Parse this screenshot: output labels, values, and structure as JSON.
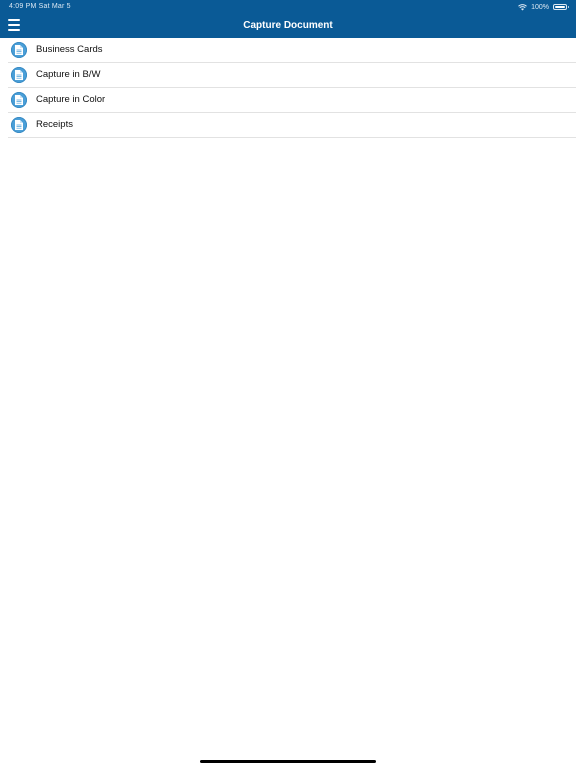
{
  "status_bar": {
    "time_date": "4:09 PM   Sat Mar 5",
    "battery_text": "100%"
  },
  "header": {
    "title": "Capture Document",
    "background_color": "#0a5a96"
  },
  "list": {
    "items": [
      {
        "label": "Business Cards",
        "icon": "document-icon"
      },
      {
        "label": "Capture in B/W",
        "icon": "document-icon"
      },
      {
        "label": "Capture in Color",
        "icon": "document-icon"
      },
      {
        "label": "Receipts",
        "icon": "document-icon"
      }
    ]
  },
  "colors": {
    "accent": "#4a9fd8"
  }
}
